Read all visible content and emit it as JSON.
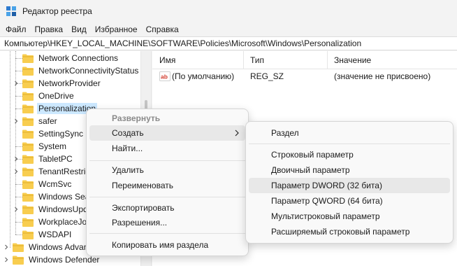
{
  "window": {
    "title": "Редактор реестра"
  },
  "menubar": {
    "items": [
      "Файл",
      "Правка",
      "Вид",
      "Избранное",
      "Справка"
    ]
  },
  "address": {
    "path": "Компьютер\\HKEY_LOCAL_MACHINE\\SOFTWARE\\Policies\\Microsoft\\Windows\\Personalization"
  },
  "tree": {
    "items": [
      "Network Connections",
      "NetworkConnectivityStatus",
      "NetworkProvider",
      "OneDrive",
      "Personalization",
      "safer",
      "SettingSync",
      "System",
      "TabletPC",
      "TenantRestric",
      "WcmSvc",
      "Windows Sea",
      "WindowsUpd",
      "WorkplaceJo",
      "WSDAPI",
      "Windows Advan",
      "Windows Defender"
    ]
  },
  "list": {
    "headers": {
      "name": "Имя",
      "type": "Тип",
      "value": "Значение"
    },
    "rows": [
      {
        "name": "(По умолчанию)",
        "type": "REG_SZ",
        "value": "(значение не присвоено)"
      }
    ]
  },
  "context_menu": {
    "items": [
      "Развернуть",
      "Создать",
      "Найти...",
      "Удалить",
      "Переименовать",
      "Экспортировать",
      "Разрешения...",
      "Копировать имя раздела"
    ]
  },
  "submenu": {
    "items": [
      "Раздел",
      "Строковый параметр",
      "Двоичный параметр",
      "Параметр DWORD (32 бита)",
      "Параметр QWORD (64 бита)",
      "Мультистроковый параметр",
      "Расширяемый строковый параметр"
    ]
  },
  "colors": {
    "folder": "#f8cd4f",
    "selection": "#cce8ff",
    "hover": "#e8e8e8",
    "disabled_text": "#8a8a8a"
  },
  "icons": {
    "app": "registry-editor-icon",
    "folder": "folder-icon",
    "string_value": "ab-string-icon",
    "submenu": "chevron-right-icon"
  }
}
